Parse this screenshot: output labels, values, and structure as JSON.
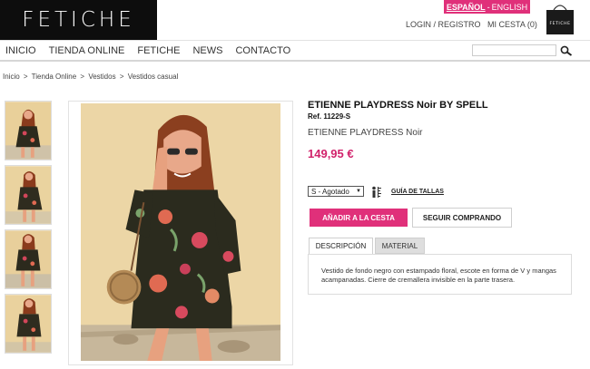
{
  "header": {
    "logo_text": "FETICHE",
    "lang_active": "ESPAÑOL",
    "lang_sep": "-",
    "lang_other": "ENGLISH",
    "login_label": "LOGIN / REGISTRO",
    "cart_label": "MI CESTA (0)",
    "bag_brand": "FETICHE"
  },
  "nav": {
    "items": [
      "INICIO",
      "TIENDA ONLINE",
      "FETICHE",
      "NEWS",
      "CONTACTO"
    ],
    "search_value": ""
  },
  "breadcrumb": [
    "Inicio",
    ">",
    "Tienda Online",
    ">",
    "Vestidos",
    ">",
    "Vestidos casual"
  ],
  "product": {
    "title": "ETIENNE PLAYDRESS Noir BY SPELL",
    "ref": "Ref. 11229-S",
    "subtitle": "ETIENNE PLAYDRESS Noir",
    "price": "149,95 €",
    "size_selected": "S - Agotado",
    "size_guide": "GUÍA DE TALLAS",
    "add_to_cart": "AÑADIR A LA CESTA",
    "continue_shopping": "SEGUIR COMPRANDO",
    "tabs": [
      "DESCRIPCIÓN",
      "MATERIAL"
    ],
    "description": "Vestido de fondo negro con estampado floral, escote en forma de V y mangas acampanadas. Cierre de cremallera invisible en la parte trasera."
  },
  "colors": {
    "accent": "#e0307a",
    "price": "#d1226b",
    "header_bg": "#0d0d0d"
  }
}
